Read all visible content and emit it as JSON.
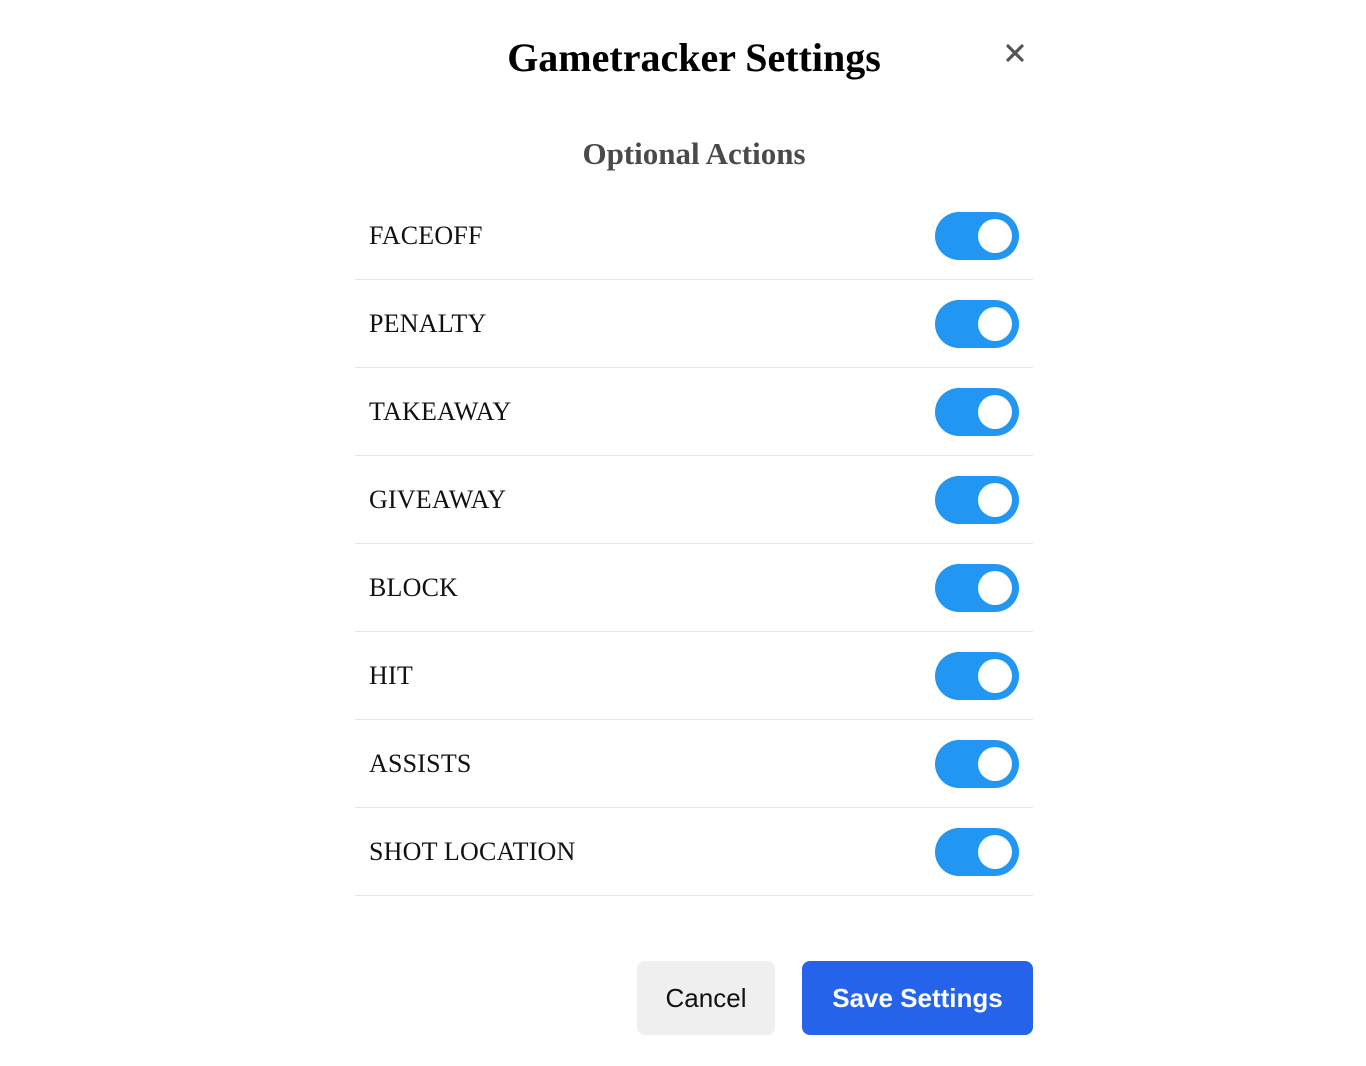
{
  "dialog": {
    "title": "Gametracker Settings",
    "subtitle": "Optional Actions",
    "close_icon": "close-icon"
  },
  "actions": [
    {
      "label": "FACEOFF",
      "enabled": true
    },
    {
      "label": "PENALTY",
      "enabled": true
    },
    {
      "label": "TAKEAWAY",
      "enabled": true
    },
    {
      "label": "GIVEAWAY",
      "enabled": true
    },
    {
      "label": "BLOCK",
      "enabled": true
    },
    {
      "label": "HIT",
      "enabled": true
    },
    {
      "label": "ASSISTS",
      "enabled": true
    },
    {
      "label": "SHOT LOCATION",
      "enabled": true
    }
  ],
  "footer": {
    "cancel_label": "Cancel",
    "save_label": "Save Settings"
  },
  "colors": {
    "toggle_on": "#2196f3",
    "save_button": "#2563eb",
    "cancel_button": "#efefef"
  }
}
